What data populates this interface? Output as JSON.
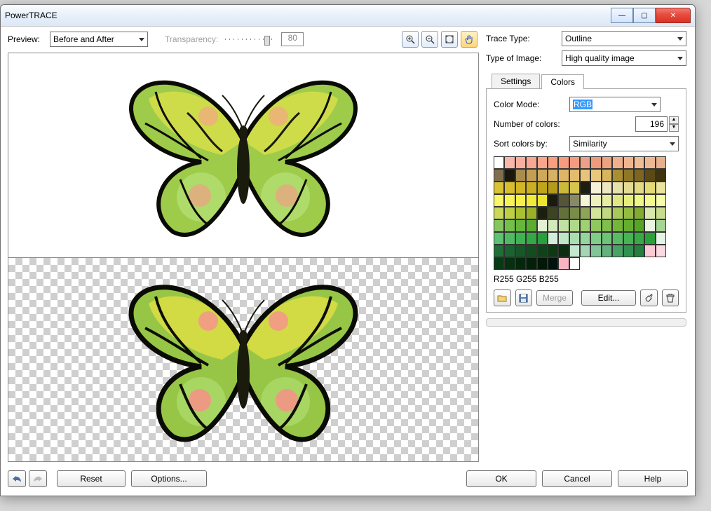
{
  "window": {
    "title": "PowerTRACE"
  },
  "toolbar": {
    "preview_label": "Preview:",
    "preview_mode": "Before and After",
    "transparency_label": "Transparency:",
    "transparency_value": "80"
  },
  "trace": {
    "type_label": "Trace Type:",
    "type_value": "Outline",
    "image_label": "Type of Image:",
    "image_value": "High quality image"
  },
  "tabs": {
    "settings": "Settings",
    "colors": "Colors",
    "active": "colors"
  },
  "colors": {
    "mode_label": "Color Mode:",
    "mode_value": "RGB",
    "num_label": "Number of colors:",
    "num_value": "196",
    "sort_label": "Sort colors by:",
    "sort_value": "Similarity",
    "selected_readout": "R255 G255 B255",
    "merge_label": "Merge",
    "edit_label": "Edit...",
    "palette": [
      "#ffffff",
      "#f9b7a9",
      "#f6b09d",
      "#f7a794",
      "#f9a58c",
      "#fa9e7f",
      "#f89a7e",
      "#f49b82",
      "#ee9f87",
      "#ec9b7d",
      "#eea37f",
      "#efb08d",
      "#f0b690",
      "#f1bd97",
      "#edb995",
      "#e8b18c",
      "#7f6f4d",
      "#1b170b",
      "#aa8d4e",
      "#c49f53",
      "#cfa95a",
      "#d9b162",
      "#dfb567",
      "#e3bc6e",
      "#e8c47a",
      "#e9c87d",
      "#d9b65c",
      "#aa8e32",
      "#8f7728",
      "#7c6620",
      "#5b4a15",
      "#3e330e",
      "#dac235",
      "#d7be2e",
      "#d2b625",
      "#cab020",
      "#c0a51b",
      "#b59b19",
      "#ccb93a",
      "#d8c54d",
      "#1e1d0f",
      "#f6f2da",
      "#ede7c1",
      "#e6e0a9",
      "#e3db93",
      "#e3da81",
      "#e5db74",
      "#ece49b",
      "#f9f66a",
      "#f7f358",
      "#f5f148",
      "#f0eb38",
      "#ebe52f",
      "#1a1a0d",
      "#555538",
      "#898967",
      "#f4f6d5",
      "#eef1bd",
      "#e7eda0",
      "#dfe683",
      "#e7ef7a",
      "#eff882",
      "#f3fb8f",
      "#f6fda7",
      "#cbd95a",
      "#bdcf44",
      "#aac033",
      "#9ab028",
      "#1b1f0e",
      "#3c4422",
      "#62703a",
      "#7a8c48",
      "#8ea458",
      "#d1e49a",
      "#c0d87f",
      "#a8c959",
      "#94bc40",
      "#82ab30",
      "#d9e9ad",
      "#c9dd8e",
      "#85c65e",
      "#74be4a",
      "#66b63b",
      "#5aad30",
      "#e2f1d3",
      "#d1e9bb",
      "#c1e1a3",
      "#b0d98b",
      "#a0d074",
      "#90c85f",
      "#81bf4c",
      "#72b73c",
      "#64ae2f",
      "#57a525",
      "#e9f5e0",
      "#a5d694",
      "#5cc372",
      "#4cbb62",
      "#3fb353",
      "#34a847",
      "#2b9e3d",
      "#d4efd9",
      "#bfe7c5",
      "#aadeb1",
      "#95d69d",
      "#80cd8a",
      "#6cc577",
      "#58bc65",
      "#46b354",
      "#37aa46",
      "#2aa13a",
      "#e4f5e6",
      "#1f6f38",
      "#1a622f",
      "#175727",
      "#144c20",
      "#11411a",
      "#0e3714",
      "#0b2d10",
      "#c6e7cf",
      "#a4d6b3",
      "#83c598",
      "#64b37e",
      "#48a266",
      "#31914f",
      "#24803f",
      "#fbcbd5",
      "#fad9e0",
      "#083a14",
      "#063010",
      "#05270c",
      "#04200a",
      "#031807",
      "#02120c",
      "#f9b4c2",
      "#",
      "",
      "",
      "",
      "",
      "",
      "",
      "",
      ""
    ]
  },
  "buttons": {
    "reset": "Reset",
    "options": "Options...",
    "ok": "OK",
    "cancel": "Cancel",
    "help": "Help"
  }
}
